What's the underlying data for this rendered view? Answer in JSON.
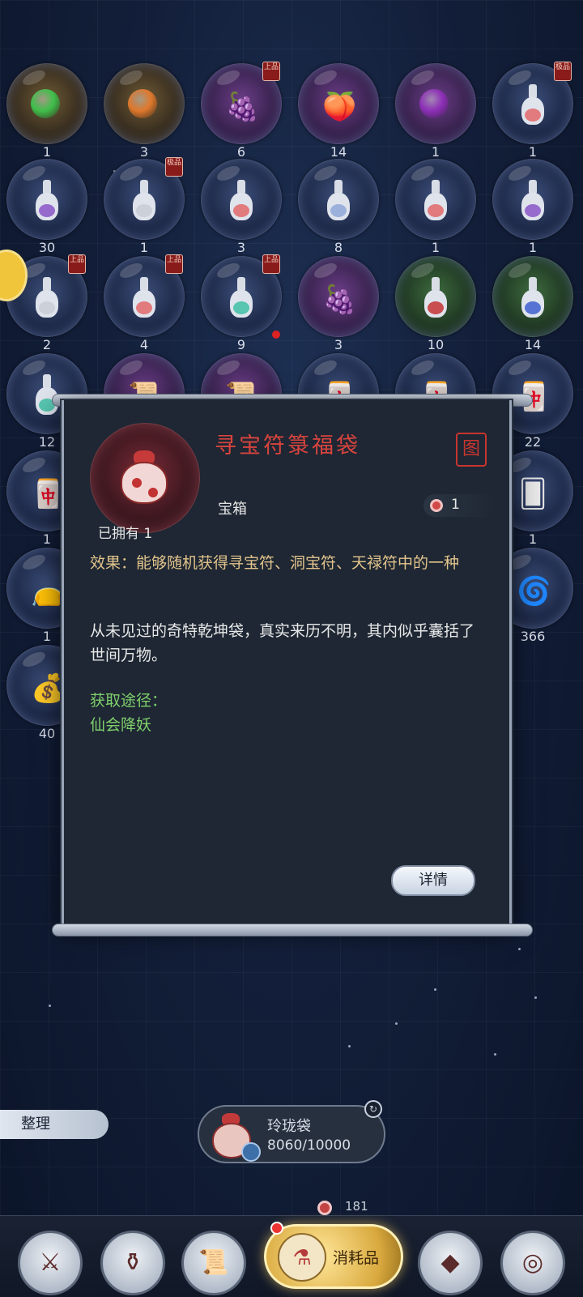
{
  "inventory": {
    "rows": [
      [
        {
          "count": "1",
          "icon": "green-orb",
          "grade": ""
        },
        {
          "count": "3",
          "icon": "orange-orb",
          "grade": ""
        },
        {
          "count": "6",
          "icon": "grapes",
          "grade": "上品"
        },
        {
          "count": "14",
          "icon": "peach",
          "grade": ""
        },
        {
          "count": "1",
          "icon": "purple-orb",
          "grade": ""
        },
        {
          "count": "1",
          "icon": "red-bottle",
          "grade": "极品"
        }
      ],
      [
        {
          "count": "30",
          "icon": "purple-bottle",
          "grade": ""
        },
        {
          "count": "1",
          "icon": "white-bottle",
          "grade": "极品"
        },
        {
          "count": "3",
          "icon": "red-bottle",
          "grade": ""
        },
        {
          "count": "8",
          "icon": "blue-bottle",
          "grade": ""
        },
        {
          "count": "1",
          "icon": "red-bottle",
          "grade": ""
        },
        {
          "count": "1",
          "icon": "purple-bottle",
          "grade": ""
        }
      ],
      [
        {
          "count": "2",
          "icon": "white-bottle",
          "grade": "上品"
        },
        {
          "count": "4",
          "icon": "red-bottle",
          "grade": "上品"
        },
        {
          "count": "9",
          "icon": "teal-bottle",
          "grade": "上品"
        },
        {
          "count": "3",
          "icon": "grapes",
          "grade": ""
        },
        {
          "count": "10",
          "icon": "red-flask",
          "grade": ""
        },
        {
          "count": "14",
          "icon": "blue-flask",
          "grade": ""
        }
      ],
      [
        {
          "count": "12",
          "icon": "teal-bottle",
          "grade": ""
        },
        {
          "count": "",
          "icon": "scroll",
          "grade": ""
        },
        {
          "count": "",
          "icon": "scroll",
          "grade": ""
        },
        {
          "count": "",
          "icon": "talisman",
          "grade": ""
        },
        {
          "count": "",
          "icon": "talisman",
          "grade": ""
        },
        {
          "count": "22",
          "icon": "talisman",
          "grade": ""
        }
      ],
      [
        {
          "count": "1",
          "icon": "talisman",
          "grade": ""
        },
        {
          "count": "1",
          "icon": "card",
          "grade": ""
        }
      ],
      [
        {
          "count": "1",
          "icon": "lucky-bag",
          "grade": ""
        },
        {
          "count": "366",
          "icon": "swirl",
          "grade": ""
        }
      ],
      [
        {
          "count": "40",
          "icon": "gold-bag",
          "grade": ""
        }
      ]
    ]
  },
  "popup": {
    "title": "寻宝符箓福袋",
    "seal_glyph": "图",
    "owned_label": "已拥有",
    "owned_count": "1",
    "type": "宝箱",
    "price": "1",
    "effect": "效果：能够随机获得寻宝符、洞宝符、天禄符中的一种",
    "lore": "从未见过的奇特乾坤袋，真实来历不明，其内似乎囊括了世间万物。",
    "source_title": "获取途径：",
    "source": "仙会降妖",
    "detail_button": "详情"
  },
  "bottom": {
    "sort_button": "整理",
    "bag_name": "玲珑袋",
    "bag_capacity": "8060/10000",
    "currency": "181"
  },
  "tabs": [
    {
      "name": "weapon-tab",
      "glyph": "⚔"
    },
    {
      "name": "material-tab",
      "glyph": "⚱"
    },
    {
      "name": "book-tab",
      "glyph": "📜"
    },
    {
      "name": "consumable-tab",
      "label": "消耗品"
    },
    {
      "name": "crystal-tab",
      "glyph": "◆"
    },
    {
      "name": "swirl-tab",
      "glyph": "◎"
    }
  ],
  "colors": {
    "title_red": "#d8443e",
    "effect_gold": "#e3c48c",
    "source_green": "#7fcf6c",
    "active_tab_gold": "#d9a93e"
  }
}
